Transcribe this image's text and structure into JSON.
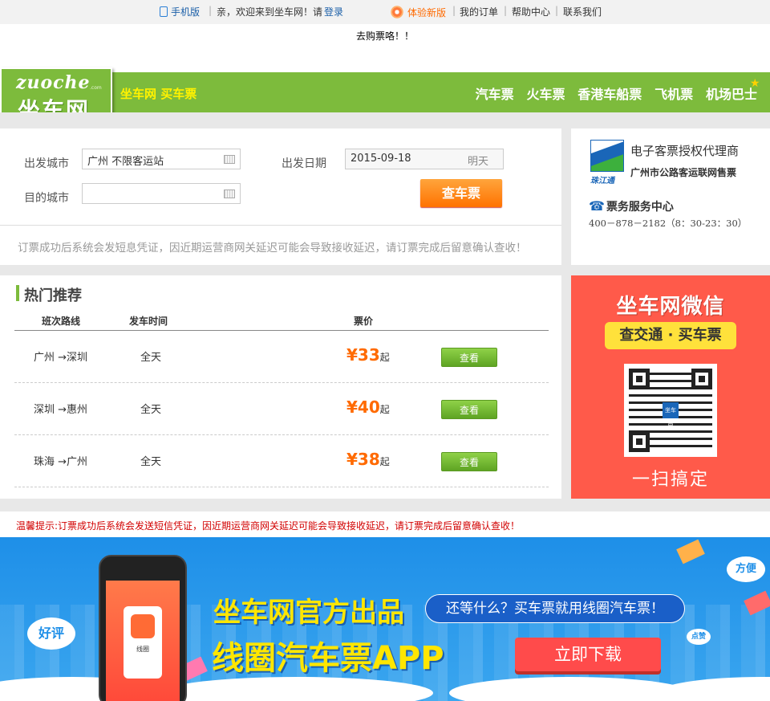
{
  "topbar": {
    "mobile": "手机版",
    "welcome": "亲，欢迎来到坐车网！请",
    "login": "登录",
    "new_version": "体验新版",
    "my_orders": "我的订单",
    "help": "帮助中心",
    "contact": "联系我们"
  },
  "notice": "去购票咯！！",
  "header": {
    "logo_en": "zuoche",
    "logo_com": ".com",
    "logo_cn": "坐车网",
    "slogan": "坐车网 买车票",
    "nav": [
      "汽车票",
      "火车票",
      "香港车船票",
      "飞机票",
      "机场巴士"
    ]
  },
  "search": {
    "from_label": "出发城市",
    "from_value": "广州  不限客运站",
    "to_label": "目的城市",
    "to_value": "",
    "date_label": "出发日期",
    "date_value": "2015-09-18",
    "date_hint": "明天",
    "submit": "查车票",
    "tip": "订票成功后系统会发短息凭证，因近期运营商网关延迟可能会导致接收延迟，请订票完成后留意确认查收！"
  },
  "agent": {
    "logo_text": "珠江通",
    "title": "电子客票授权代理商",
    "subtitle": "广州市公路客运联网售票",
    "service": "票务服务中心",
    "phone": "400－878－2182（8：30-23：30）"
  },
  "hot": {
    "title": "热门推荐",
    "columns": [
      "班次路线",
      "发车时间",
      "票价"
    ],
    "rows": [
      {
        "route": "广州 →深圳",
        "time": "全天",
        "price": "¥33",
        "suffix": "起",
        "action": "查看"
      },
      {
        "route": "深圳 →惠州",
        "time": "全天",
        "price": "¥40",
        "suffix": "起",
        "action": "查看"
      },
      {
        "route": "珠海 →广州",
        "time": "全天",
        "price": "¥38",
        "suffix": "起",
        "action": "查看"
      }
    ]
  },
  "wechat": {
    "title": "坐车网微信",
    "subtitle": "查交通 · 买车票",
    "qr_logo": "坐车网",
    "scan": "一扫搞定"
  },
  "warm_tip": "温馨提示:订票成功后系统会发送短信凭证，因近期运营商网关延迟可能会导致接收延迟，请订票完成后留意确认查收！",
  "banner": {
    "title": "坐车网官方出品",
    "app": "线圈汽车票APP",
    "question": "还等什么？买车票就用线圈汽车票！",
    "download": "立即下载",
    "bubble_left": "好评",
    "bubble_right": "方便",
    "bubble_small": "点赞",
    "phone_app_name": "线圈"
  },
  "colors": {
    "brand_green": "#7dbb3c",
    "accent_orange": "#ff6a00",
    "wechat_red": "#ff5a4a",
    "banner_blue": "#1e8fe8"
  }
}
